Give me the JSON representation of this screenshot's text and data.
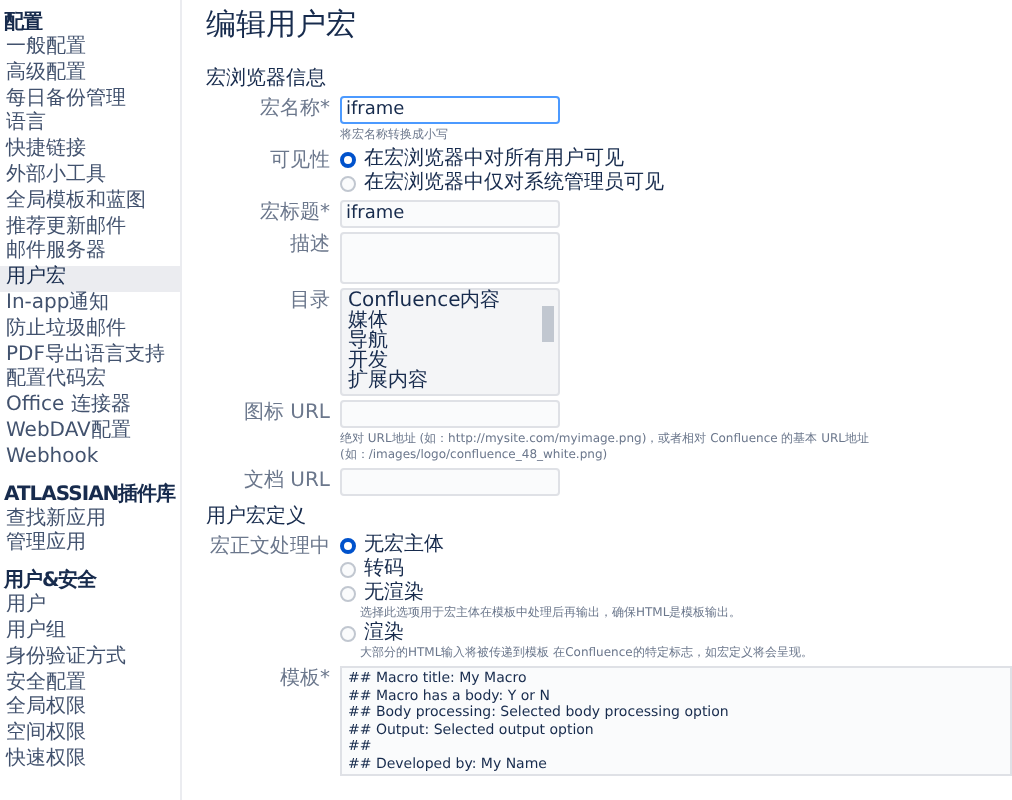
{
  "sidebar": {
    "sections": [
      {
        "heading": "配置",
        "items": [
          {
            "label": "一般配置",
            "selected": false
          },
          {
            "label": "高级配置",
            "selected": false
          },
          {
            "label": "每日备份管理",
            "selected": false
          },
          {
            "label": "语言",
            "selected": false
          },
          {
            "label": "快捷链接",
            "selected": false
          },
          {
            "label": "外部小工具",
            "selected": false
          },
          {
            "label": "全局模板和蓝图",
            "selected": false
          },
          {
            "label": "推荐更新邮件",
            "selected": false
          },
          {
            "label": "邮件服务器",
            "selected": false
          },
          {
            "label": "用户宏",
            "selected": true
          },
          {
            "label": "In-app通知",
            "selected": false
          },
          {
            "label": "防止垃圾邮件",
            "selected": false
          },
          {
            "label": "PDF导出语言支持",
            "selected": false
          },
          {
            "label": "配置代码宏",
            "selected": false
          },
          {
            "label": "Office 连接器",
            "selected": false
          },
          {
            "label": "WebDAV配置",
            "selected": false
          },
          {
            "label": "Webhook",
            "selected": false
          }
        ]
      },
      {
        "heading": "ATLASSIAN插件库",
        "items": [
          {
            "label": "查找新应用",
            "selected": false
          },
          {
            "label": "管理应用",
            "selected": false
          }
        ]
      },
      {
        "heading": "用户&安全",
        "items": [
          {
            "label": "用户",
            "selected": false
          },
          {
            "label": "用户组",
            "selected": false
          },
          {
            "label": "身份验证方式",
            "selected": false
          },
          {
            "label": "安全配置",
            "selected": false
          },
          {
            "label": "全局权限",
            "selected": false
          },
          {
            "label": "空间权限",
            "selected": false
          },
          {
            "label": "快速权限",
            "selected": false
          }
        ]
      }
    ]
  },
  "title": "编辑用户宏",
  "browser_section": {
    "heading": "宏浏览器信息",
    "fields": [
      {
        "kind": "text",
        "label": "宏名称*",
        "value": "iframe",
        "focused": true,
        "hint": "将宏名称转换成小写"
      },
      {
        "kind": "radio",
        "label": "可见性",
        "options": [
          {
            "label": "在宏浏览器中对所有用户可见",
            "selected": true
          },
          {
            "label": "在宏浏览器中仅对系统管理员可见",
            "selected": false
          }
        ]
      },
      {
        "kind": "text",
        "label": "宏标题*",
        "value": "iframe",
        "focused": false
      },
      {
        "kind": "textarea",
        "label": "描述"
      },
      {
        "kind": "listbox",
        "label": "目录",
        "options": [
          {
            "label": "Confluence内容",
            "selected": false
          },
          {
            "label": "媒体",
            "selected": false
          },
          {
            "label": "导航",
            "selected": false
          },
          {
            "label": "开发",
            "selected": false
          },
          {
            "label": "扩展内容",
            "selected": false
          }
        ]
      },
      {
        "kind": "text",
        "label": "图标 URL",
        "focused": false,
        "hint": "绝对 URL地址 (如：http://mysite.com/myimage.png)，或者相对 Confluence 的基本 URL地址 (如：/images/logo/confluence_48_white.png)"
      },
      {
        "kind": "text",
        "label": "文档 URL",
        "focused": false
      }
    ]
  },
  "definition_section": {
    "heading": "用户宏定义",
    "body_processing": {
      "label": "宏正文处理中",
      "options": [
        {
          "label": "无宏主体",
          "selected": true
        },
        {
          "label": "转码",
          "selected": false
        },
        {
          "label": "无渲染",
          "selected": false,
          "description": "选择此选项用于宏主体在模板中处理后再输出，确保HTML是模板输出。"
        },
        {
          "label": "渲染",
          "selected": false,
          "description": "大部分的HTML输入将被传递到模板 在Confluence的特定标志，如宏定义将会呈现。"
        }
      ]
    },
    "template": {
      "label": "模板*",
      "lines": [
        "## Macro title: My Macro",
        "## Macro has a body: Y or N",
        "## Body processing: Selected body processing option",
        "## Output: Selected output option",
        "##",
        "## Developed by: My Name"
      ]
    }
  }
}
